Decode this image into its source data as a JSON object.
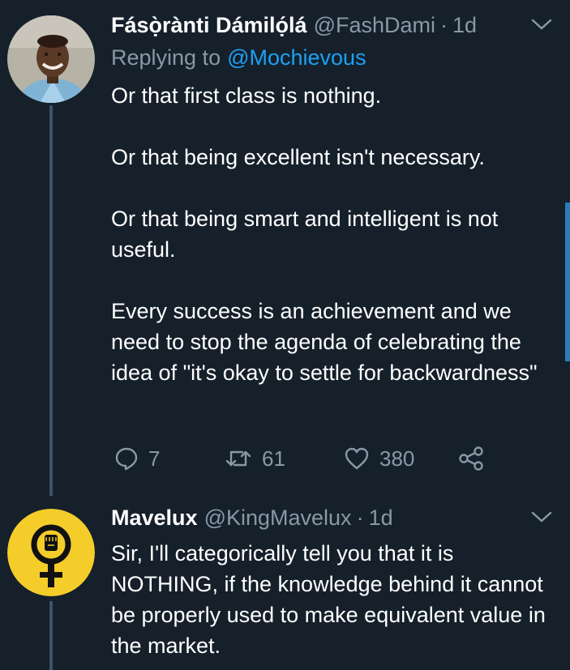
{
  "colors": {
    "background": "#15202b",
    "secondary_text": "#8899a6",
    "link": "#1da1f2",
    "thread_line": "#3d5466",
    "scrollbar": "#2b7bb9"
  },
  "tweets": [
    {
      "name": "Fásọ̀rànti Dámilọ́lá",
      "handle": "@FashDami",
      "separator": "·",
      "time": "1d",
      "replying_prefix": "Replying to",
      "replying_to": "@Mochievous",
      "paragraphs": [
        "Or that first class is nothing.",
        "Or that being excellent isn't necessary.",
        "Or that being smart and intelligent is not useful.",
        "Every success is an achievement and we need to stop the agenda of celebrating the idea of \"it's okay to settle for backwardness\""
      ],
      "actions": {
        "reply_count": "7",
        "retweet_count": "61",
        "like_count": "380"
      },
      "avatar_icon": "user-photo-avatar"
    },
    {
      "name": "Mavelux",
      "handle": "@KingMavelux",
      "separator": "·",
      "time": "1d",
      "paragraphs": [
        "Sir, I'll categorically tell you that it is NOTHING, if the knowledge behind it cannot be properly used to make equivalent value in the market."
      ],
      "avatar_icon": "female-symbol-fist-avatar"
    }
  ]
}
